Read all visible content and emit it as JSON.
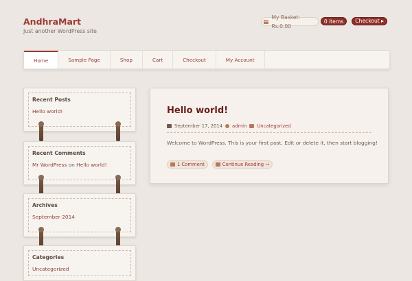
{
  "site": {
    "title": "AndhraMart",
    "tagline": "Just another WordPress site"
  },
  "header": {
    "basket_label": "My Basket: Rs.0.00",
    "items_label": "0 items",
    "checkout_label": "Checkout"
  },
  "nav": {
    "items": [
      {
        "label": "Home",
        "active": true
      },
      {
        "label": "Sample Page",
        "active": false
      },
      {
        "label": "Shop",
        "active": false
      },
      {
        "label": "Cart",
        "active": false
      },
      {
        "label": "Checkout",
        "active": false
      },
      {
        "label": "My Account",
        "active": false
      }
    ]
  },
  "sidebar": {
    "recent_posts": {
      "title": "Recent Posts",
      "items": [
        "Hello world!"
      ]
    },
    "recent_comments": {
      "title": "Recent Comments",
      "author": "Mr WordPress",
      "on": "on",
      "post": "Hello world!"
    },
    "archives": {
      "title": "Archives",
      "items": [
        "September 2014"
      ]
    },
    "categories": {
      "title": "Categories",
      "items": [
        "Uncategorized"
      ]
    }
  },
  "post": {
    "title": "Hello world!",
    "date": "September 17, 2014",
    "author": "admin",
    "category": "Uncategorized",
    "body": "Welcome to WordPress. This is your first post. Edit or delete it, then start blogging!",
    "comments_label": "1 Comment",
    "continue_label": "Continue Reading →"
  },
  "colors": {
    "accent": "#9e3a32",
    "background": "#ece7e2"
  }
}
